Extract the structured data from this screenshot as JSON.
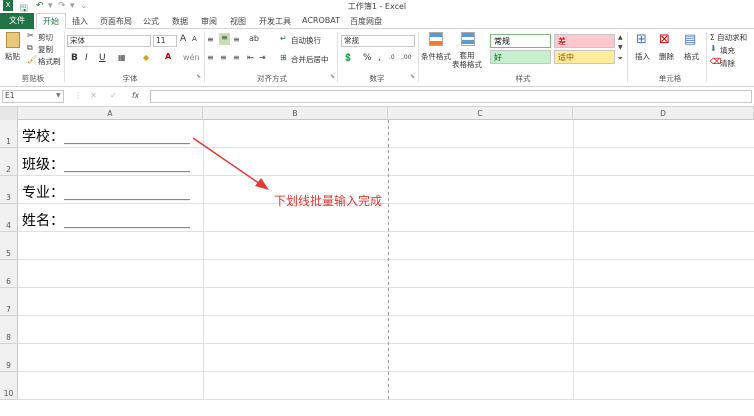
{
  "window": {
    "title": "工作簿1 - Excel"
  },
  "tabs": [
    "文件",
    "开始",
    "插入",
    "页面布局",
    "公式",
    "数据",
    "审阅",
    "视图",
    "开发工具",
    "ACROBAT",
    "百度网盘"
  ],
  "clipboard": {
    "paste": "粘贴",
    "cut": "剪切",
    "copy": "复制",
    "format_painter": "格式刷",
    "label": "剪贴板"
  },
  "font": {
    "name": "宋体",
    "size": "11",
    "label": "字体",
    "grow": "A",
    "shrink": "A",
    "bold": "B",
    "italic": "I",
    "underline": "U"
  },
  "alignment": {
    "wrap": "自动换行",
    "merge": "合并后居中",
    "label": "对齐方式"
  },
  "number": {
    "format": "常规",
    "percent": "%",
    "comma": ",",
    "label": "数字"
  },
  "styles": {
    "conditional": "条件格式",
    "table": "套用\n表格格式",
    "normal": "常规",
    "bad": "差",
    "good": "好",
    "neutral": "适中",
    "label": "样式"
  },
  "cells": {
    "insert": "插入",
    "delete": "删除",
    "format": "格式",
    "label": "单元格"
  },
  "editing": {
    "autosum": "Σ 自动求和",
    "fill": "填充",
    "clear": "清除"
  },
  "formula_bar": {
    "name_box": "E1",
    "fx": "fx",
    "value": ""
  },
  "columns": [
    "A",
    "B",
    "C",
    "D"
  ],
  "rows": [
    "1",
    "2",
    "3",
    "4",
    "5",
    "6",
    "7",
    "8",
    "9",
    "10"
  ],
  "cells_content": [
    {
      "text": "学校：__________________"
    },
    {
      "text": "班级：__________________"
    },
    {
      "text": "专业：__________________"
    },
    {
      "text": "姓名：__________________"
    }
  ],
  "annotation": {
    "text": "下划线批量输入完成",
    "color": "#e53935"
  },
  "colors": {
    "brand": "#217346",
    "normal_bg": "#ffffff",
    "bad_bg": "#ffc7ce",
    "bad_fg": "#9c0006",
    "good_bg": "#c6efce",
    "good_fg": "#006100",
    "neutral_bg": "#ffeb9c",
    "neutral_fg": "#9c5700"
  }
}
